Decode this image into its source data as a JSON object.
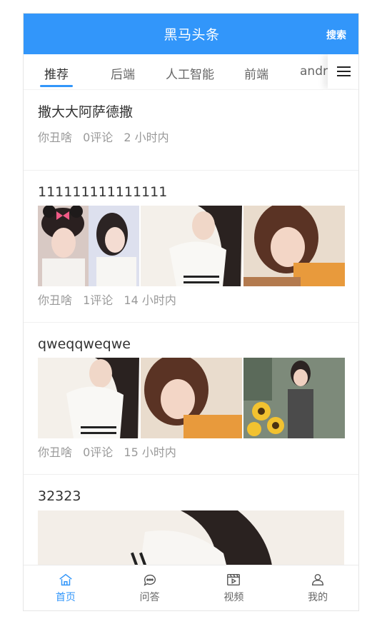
{
  "header": {
    "title": "黑马头条",
    "search_label": "搜索"
  },
  "tabs": [
    {
      "label": "推荐"
    },
    {
      "label": "后端"
    },
    {
      "label": "人工智能"
    },
    {
      "label": "前端"
    },
    {
      "label": "andr"
    }
  ],
  "articles": [
    {
      "title": "撒大大阿萨德撒",
      "author": "你丑啥",
      "comments": "0评论",
      "time": "2 小时内"
    },
    {
      "title": "111111111111111",
      "author": "你丑啥",
      "comments": "1评论",
      "time": "14 小时内"
    },
    {
      "title": "qweqqweqwe",
      "author": "你丑啥",
      "comments": "0评论",
      "time": "15 小时内"
    },
    {
      "title": "32323"
    }
  ],
  "tabbar": [
    {
      "label": "首页",
      "icon": "home-icon"
    },
    {
      "label": "问答",
      "icon": "chat-icon"
    },
    {
      "label": "视频",
      "icon": "video-icon"
    },
    {
      "label": "我的",
      "icon": "user-icon"
    }
  ],
  "colors": {
    "primary": "#3296fa",
    "text": "#333333",
    "muted": "#999999"
  }
}
